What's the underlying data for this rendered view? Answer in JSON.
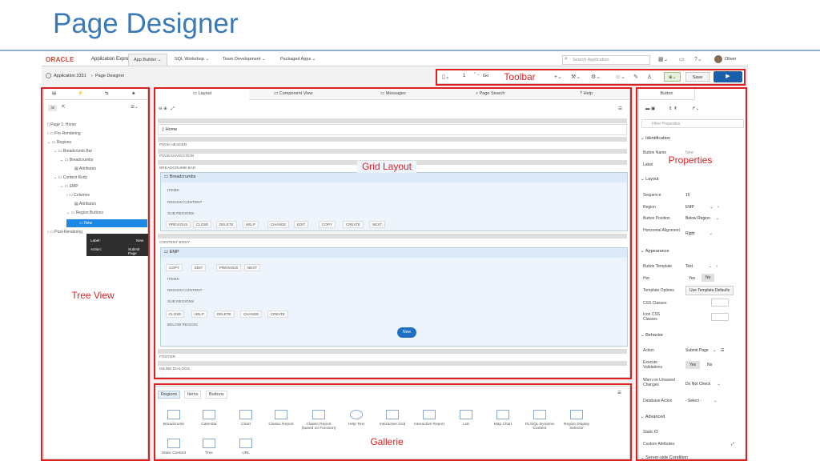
{
  "slide": {
    "title": "Page Designer"
  },
  "topnav": {
    "logo": "ORACLE",
    "product": "Application Express",
    "tabs": [
      "App Builder",
      "SQL Workshop",
      "Team Development",
      "Packaged Apps"
    ],
    "search_placeholder": "Search Application",
    "user": "Oliver"
  },
  "breadcrumbs": [
    "Application 3331",
    "Page Designer"
  ],
  "toolbar": {
    "page_number": "1",
    "go": "Go",
    "save": "Save"
  },
  "tree": {
    "items": [
      "Page 1: Home",
      "Pre-Rendering",
      "Regions",
      "Breadcrumb Bar",
      "Breadcrumbs",
      "Attributes",
      "Content Body",
      "EMP",
      "Columns",
      "Attributes",
      "Region Buttons",
      "New",
      "Post-Rendering"
    ],
    "tooltip": {
      "label_key": "Label:",
      "label_val": "New",
      "action_key": "Action:",
      "action_val": "Submit Page"
    }
  },
  "grid": {
    "tabs": [
      "Layout",
      "Component View",
      "Messages",
      "Page Search",
      "Help"
    ],
    "page_name": "Home",
    "rows": {
      "page_header": "PAGE HEADER",
      "page_navigation": "PAGE NAVIGATION",
      "breadcrumb_bar": "BREADCRUMB BAR",
      "breadcrumbs_region": "Breadcrumbs",
      "items": "ITEMS",
      "region_content": "REGION CONTENT",
      "sub_regions": "SUB REGIONS",
      "content_body": "CONTENT BODY",
      "emp_region": "EMP",
      "below_region": "BELOW REGION",
      "footer": "FOOTER",
      "inline_dialogs": "INLINE DIALOGS",
      "new_button": "New"
    },
    "bc_buttons": [
      "PREVIOUS",
      "CLOSE",
      "DELETE",
      "HELP",
      "CHANGE",
      "EDIT",
      "COPY",
      "CREATE",
      "NEXT"
    ],
    "emp_top_buttons": [
      "COPY",
      "EDIT",
      "PREVIOUS",
      "NEXT"
    ],
    "emp_bottom_buttons": [
      "CLOSE",
      "HELP",
      "DELETE",
      "CHANGE",
      "CREATE"
    ]
  },
  "gallery": {
    "tabs": [
      "Regions",
      "Items",
      "Buttons"
    ],
    "items": [
      "Breadcrumb",
      "Calendar",
      "Chart",
      "Classic Report",
      "Classic Report (based on Function)",
      "Help Text",
      "Interactive Grid",
      "Interactive Report",
      "List",
      "Map Chart",
      "PL/SQL Dynamic Content",
      "Region Display Selector",
      "Static Content",
      "Tree",
      "URL"
    ]
  },
  "properties": {
    "tab": "Button",
    "filter_placeholder": "Filter Properties",
    "identification": "Identification",
    "button_name": "Button Name",
    "button_name_val": "New",
    "label": "Label",
    "layout": "Layout",
    "sequence": "Sequence",
    "sequence_val": "10",
    "region": "Region",
    "region_val": "EMP",
    "button_position": "Button Position",
    "button_position_val": "Below Region",
    "horizontal_alignment": "Horizontal Alignment",
    "horizontal_alignment_val": "Right",
    "appearance": "Appearance",
    "button_template": "Button Template",
    "button_template_val": "Text",
    "hot": "Hot",
    "yes": "Yes",
    "no": "No",
    "template_options": "Template Options",
    "template_options_val": "Use Template Defaults",
    "css_classes": "CSS Classes",
    "icon_css_classes": "Icon CSS Classes",
    "behavior": "Behavior",
    "action": "Action",
    "action_val": "Submit Page",
    "execute_validations": "Execute Validations",
    "warn_unsaved": "Warn on Unsaved Changes",
    "warn_unsaved_val": "Do Not Check",
    "database_action": "Database Action",
    "database_action_val": "- Select -",
    "advanced": "Advanced",
    "static_id": "Static ID",
    "custom_attributes": "Custom Attributes",
    "server_side_condition": "Server-side Condition"
  },
  "annotations": {
    "toolbar": "Toolbar",
    "grid_layout": "Grid Layout",
    "properties": "Properties",
    "tree_view": "Tree View",
    "gallerie": "Gallerie",
    "color": "#e02020"
  }
}
